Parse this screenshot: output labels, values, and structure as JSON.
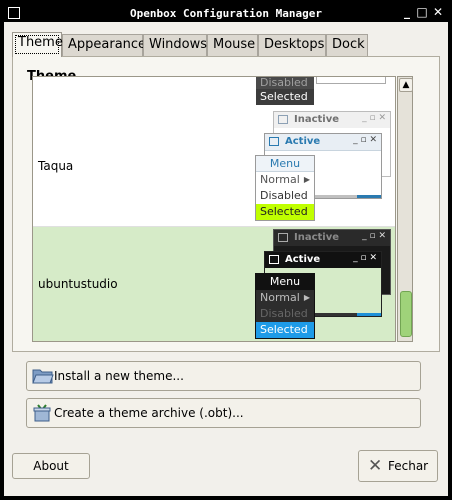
{
  "window": {
    "title": "Openbox Configuration Manager"
  },
  "tabs": [
    {
      "label": "Theme"
    },
    {
      "label": "Appearance"
    },
    {
      "label": "Windows"
    },
    {
      "label": "Mouse"
    },
    {
      "label": "Desktops"
    },
    {
      "label": "Dock"
    }
  ],
  "panel": {
    "heading": "Theme"
  },
  "themes": [
    {
      "name": "Taqua",
      "preview": {
        "inactive": "Inactive",
        "active": "Active",
        "menu": "Menu",
        "normal": "Normal",
        "disabled": "Disabled",
        "selected": "Selected"
      }
    },
    {
      "name": "ubuntustudio",
      "preview": {
        "inactive": "Inactive",
        "active": "Active",
        "menu": "Menu",
        "normal": "Normal",
        "disabled": "Disabled",
        "selected": "Selected"
      }
    }
  ],
  "partial_preview": {
    "disabled": "Disabled",
    "selected": "Selected"
  },
  "buttons": {
    "install": "Install a new theme...",
    "archive": "Create a theme archive (.obt)...",
    "about": "About",
    "close": "Fechar"
  }
}
